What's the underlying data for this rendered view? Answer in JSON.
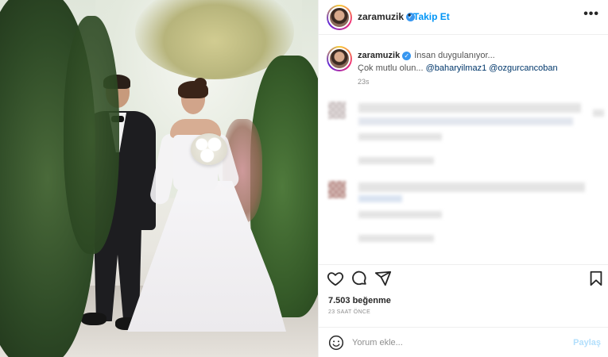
{
  "post": {
    "username": "zaramuzik",
    "follow_label": "Takip Et",
    "more_label": "•••"
  },
  "caption": {
    "username": "zaramuzik",
    "text": "İnsan duygulanıyor...",
    "line2_prefix": "Çok mutlu olun... ",
    "mention1": "@baharyilmaz1",
    "mention2": "@ozgurcancoban",
    "time": "23s"
  },
  "stats": {
    "likes": "7.503 beğenme",
    "posted_ago": "23 SAAT ÖNCE"
  },
  "comment_box": {
    "placeholder": "Yorum ekle...",
    "post_label": "Paylaş"
  },
  "icons": {
    "like": "heart-icon",
    "comment": "comment-icon",
    "share": "share-icon",
    "save": "bookmark-icon",
    "emoji": "emoji-icon",
    "verified": "verified-badge-icon",
    "more": "more-options-icon"
  },
  "colors": {
    "accent": "#0095f6",
    "mention": "#00376b",
    "verified": "#3897f0",
    "muted": "#8e8e8e"
  }
}
